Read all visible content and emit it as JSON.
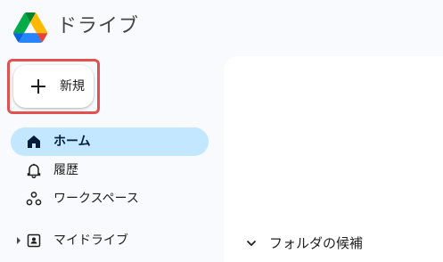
{
  "app": {
    "title": "ドライブ",
    "logo_icon": "google-drive-logo"
  },
  "new_button": {
    "label": "新規",
    "icon": "plus-icon",
    "highlight_color": "#e0514f"
  },
  "sidebar": {
    "items": [
      {
        "label": "ホーム",
        "icon": "home-icon",
        "active": true
      },
      {
        "label": "履歴",
        "icon": "bell-icon",
        "active": false
      },
      {
        "label": "ワークスペース",
        "icon": "workspaces-icon",
        "active": false
      },
      {
        "label": "マイドライブ",
        "icon": "my-drive-icon",
        "active": false,
        "expandable": true
      }
    ],
    "active_color": "#c2e7ff"
  },
  "main": {
    "section": {
      "label": "フォルダの候補",
      "icon": "chevron-down-icon"
    }
  }
}
